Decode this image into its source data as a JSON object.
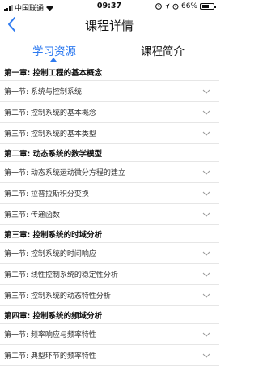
{
  "status_bar": {
    "carrier": "中国联通",
    "time": "09:37",
    "battery": "66%",
    "battery_level": 0.66
  },
  "nav": {
    "title": "课程详情",
    "back_icon": "chevron-left-icon"
  },
  "tabs": [
    {
      "label": "学习资源",
      "active": true
    },
    {
      "label": "课程简介",
      "active": false
    }
  ],
  "colors": {
    "accent": "#2f7bf0",
    "divider": "#e6e6e6"
  },
  "chapters": [
    {
      "title": "第一章: 控制工程的基本概念",
      "sections": [
        "第一节: 系统与控制系统",
        "第二节: 控制系统的基本概念",
        "第三节: 控制系统的基本类型"
      ]
    },
    {
      "title": "第二章: 动态系统的数学模型",
      "sections": [
        "第一节: 动态系统运动微分方程的建立",
        "第二节: 拉普拉斯积分变换",
        "第三节: 传递函数"
      ]
    },
    {
      "title": "第三章: 控制系统的时域分析",
      "sections": [
        "第一节: 控制系统的时间响应",
        "第二节: 线性控制系统的稳定性分析",
        "第三节: 控制系统的动态特性分析"
      ]
    },
    {
      "title": "第四章: 控制系统的频域分析",
      "sections": [
        "第一节: 频率响应与频率特性",
        "第二节: 典型环节的频率特性"
      ]
    }
  ]
}
